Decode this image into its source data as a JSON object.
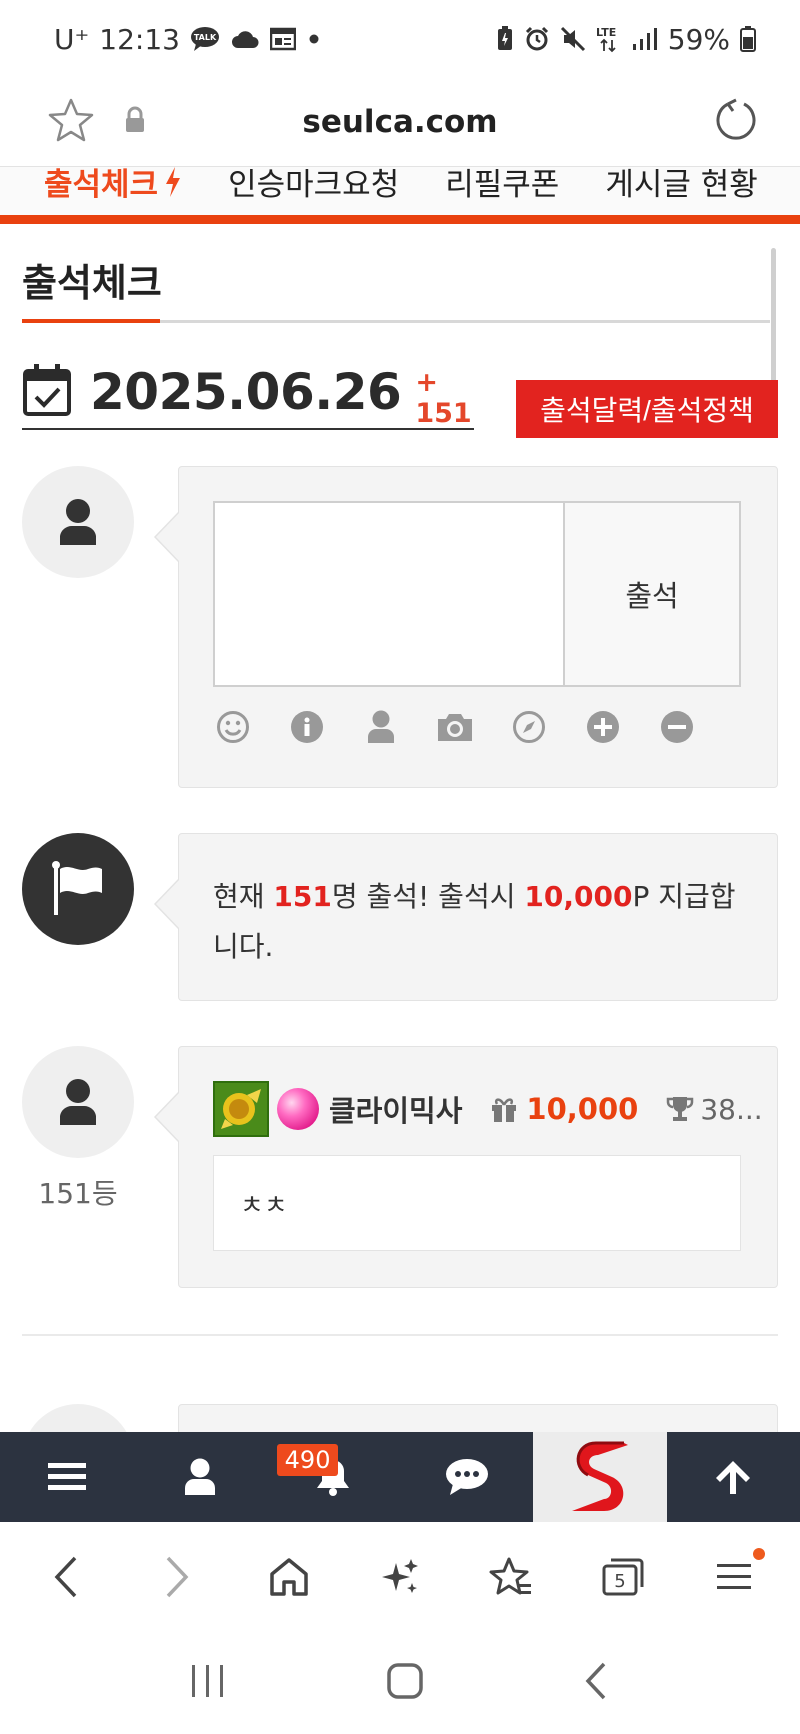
{
  "status_bar": {
    "carrier": "U⁺",
    "time": "12:13",
    "battery": "59%"
  },
  "browser": {
    "url": "seulca.com"
  },
  "site_nav": {
    "items": [
      "출석체크",
      "인승마크요청",
      "리필쿠폰",
      "게시글 현황"
    ],
    "active_index": 0
  },
  "page": {
    "title": "출석체크",
    "date": "2025.06.26",
    "count": "+ 151",
    "policy_button": "출석달력/출석정책"
  },
  "compose": {
    "submit_label": "출석"
  },
  "notice": {
    "prefix": "현재 ",
    "count": "151",
    "middle": "명 출석! 출석시 ",
    "points": "10,000",
    "suffix": "P 지급합니다."
  },
  "entry": {
    "nickname": "클라이믹사",
    "points": "10,000",
    "score": "38...",
    "rank": "151등",
    "comment": "ㅊㅊ"
  },
  "site_bar": {
    "notification_count": "490"
  },
  "browser_bar": {
    "tab_count": "5"
  },
  "colors": {
    "accent": "#e9410f",
    "red": "#e2231f",
    "dark_bar": "#2c3340"
  }
}
